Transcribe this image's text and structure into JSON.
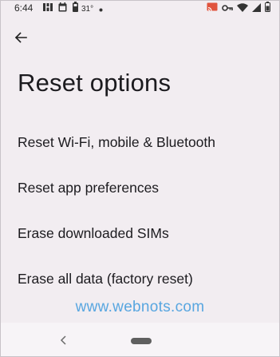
{
  "status_bar": {
    "time": "6:44",
    "temperature": "31°",
    "left_icons": [
      "google-fit-icon",
      "calendar-icon",
      "battery-saver-icon"
    ],
    "right_icons": [
      "cast-icon",
      "vpn-key-icon",
      "wifi-icon",
      "signal-icon",
      "battery-icon"
    ]
  },
  "header": {
    "back_icon": "arrow-back-icon",
    "title": "Reset options"
  },
  "options": [
    {
      "label": "Reset Wi-Fi, mobile & Bluetooth"
    },
    {
      "label": "Reset app preferences"
    },
    {
      "label": "Erase downloaded SIMs"
    },
    {
      "label": "Erase all data (factory reset)"
    }
  ],
  "watermark": "www.webnots.com",
  "nav_bar": {
    "back_icon": "nav-back-icon",
    "home_icon": "home-pill-icon"
  },
  "colors": {
    "background": "#f2edf1",
    "text": "#1c1b1f",
    "watermark": "#58a6e0"
  }
}
